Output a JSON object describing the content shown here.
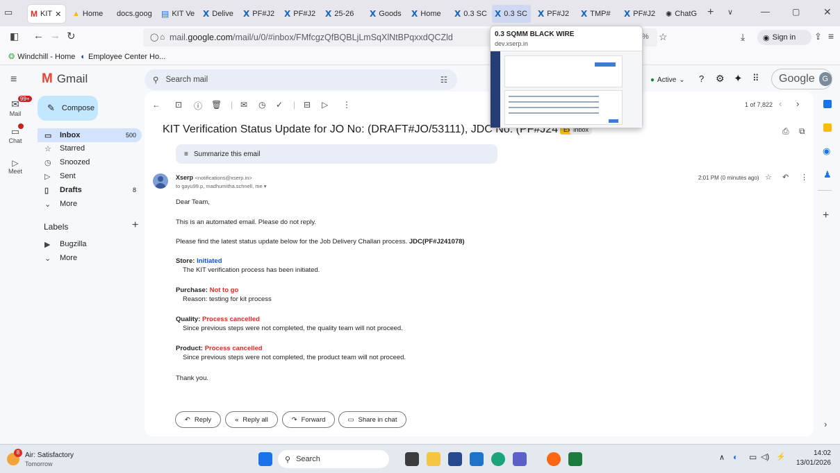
{
  "browser": {
    "tabs": [
      {
        "label": "KIT",
        "icon": "gmail-icon"
      },
      {
        "label": "Home",
        "icon": "drive-icon"
      },
      {
        "label": "docs.goog",
        "icon": ""
      },
      {
        "label": "KIT Ve",
        "icon": "sheets-icon"
      },
      {
        "label": "Delive",
        "icon": "xserp-icon"
      },
      {
        "label": "PF#J2",
        "icon": "xserp-icon"
      },
      {
        "label": "PF#J2",
        "icon": "xserp-icon"
      },
      {
        "label": "25-26",
        "icon": "xserp-icon"
      },
      {
        "label": "Goods",
        "icon": "xserp-icon"
      },
      {
        "label": "Home",
        "icon": "xserp-icon"
      },
      {
        "label": "0.3 SC",
        "icon": "xserp-icon"
      },
      {
        "label": "0.3 SC",
        "icon": "xserp-icon"
      },
      {
        "label": "PF#J2",
        "icon": "xserp-icon"
      },
      {
        "label": "TMP#",
        "icon": "xserp-icon"
      },
      {
        "label": "PF#J2",
        "icon": "xserp-icon"
      },
      {
        "label": "ChatG",
        "icon": "chatgpt-icon"
      }
    ],
    "url_prefix": "mail.",
    "url_domain": "google.com",
    "url_path": "/mail/u/0/#inbox/FMfcgzQfBQBLjLmSqXlNtBPqxxdQCZld",
    "zoom": "%",
    "sign_in": "Sign in",
    "bookmarks": [
      "Windchill - Home",
      "Employee Center Ho..."
    ],
    "tab_preview": {
      "title": "0.3 SQMM BLACK WIRE",
      "domain": "dev.xserp.in"
    }
  },
  "gmail": {
    "logo": "Gmail",
    "search_placeholder": "Search mail",
    "status": "Active",
    "google_label": "Google",
    "avatar_letter": "G",
    "rail": [
      {
        "label": "Mail",
        "badge": "99+"
      },
      {
        "label": "Chat",
        "badge": ""
      },
      {
        "label": "Meet",
        "badge": ""
      }
    ],
    "compose": "Compose",
    "nav": [
      {
        "label": "Inbox",
        "count": "500"
      },
      {
        "label": "Starred",
        "count": ""
      },
      {
        "label": "Snoozed",
        "count": ""
      },
      {
        "label": "Sent",
        "count": ""
      },
      {
        "label": "Drafts",
        "count": "8"
      },
      {
        "label": "More",
        "count": ""
      }
    ],
    "labels_title": "Labels",
    "labels": [
      {
        "label": "Bugzilla"
      },
      {
        "label": "More"
      }
    ],
    "pager": "1 of 7,822",
    "subject": "KIT Verification Status Update for JO No: (DRAFT#JO/53111), JDC No: (PF#J241078)",
    "tag_external": "External",
    "tag_inbox": "Inbox",
    "summarize": "Summarize this email",
    "sender_name": "Xserp",
    "sender_email": "<notifications@xserp.in>",
    "recipients": "to gayu99.p, madhumitha.schnell, me",
    "time": "2:01 PM (0 minutes ago)",
    "body": {
      "greeting": "Dear Team,",
      "p1": "This is an automated email. Please do not reply.",
      "p2": "Please find the latest status update below for the Job Delivery Challan process.",
      "p2_bold": "JDC(PF#J241078)",
      "store_label": "Store:",
      "store_status": "Initiated",
      "store_note": "The KIT verification process has been initiated.",
      "purchase_label": "Purchase:",
      "purchase_status": "Not to go",
      "purchase_note": "Reason: testing for kit process",
      "quality_label": "Quality:",
      "quality_status": "Process cancelled",
      "quality_note": "Since previous steps were not completed, the quality team will not proceed.",
      "product_label": "Product:",
      "product_status": "Process cancelled",
      "product_note": "Since previous steps were not completed, the product team will not proceed.",
      "closing": "Thank you."
    },
    "actions": {
      "reply": "Reply",
      "reply_all": "Reply all",
      "forward": "Forward",
      "share": "Share in chat"
    }
  },
  "taskbar": {
    "weather_title": "Air: Satisfactory",
    "weather_sub": "Tomorrow",
    "weather_badge": "8",
    "search": "Search",
    "time": "14:02",
    "date": "13/01/2026"
  },
  "colors": {
    "blue_status": "#0b57d0",
    "red_status": "#d93025",
    "tag_external": "#f5c518"
  }
}
